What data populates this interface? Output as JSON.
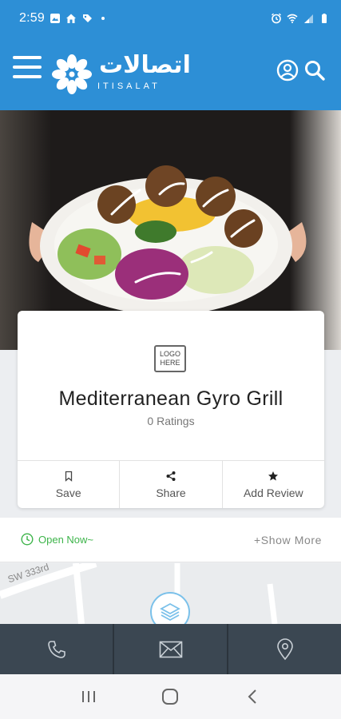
{
  "status_bar": {
    "time": "2:59"
  },
  "header": {
    "brand_arabic": "اتصالات",
    "brand_latin": "ITISALAT",
    "colors": {
      "primary": "#2d8fd6"
    }
  },
  "listing": {
    "logo_placeholder": [
      "LOGO",
      "HERE"
    ],
    "name": "Mediterranean Gyro Grill",
    "ratings": "0 Ratings",
    "actions": [
      {
        "label": "Save",
        "icon": "bookmark-icon"
      },
      {
        "label": "Share",
        "icon": "share-icon"
      },
      {
        "label": "Add Review",
        "icon": "star-icon"
      }
    ]
  },
  "hours": {
    "status": "Open Now~",
    "show_more": "+Show More",
    "status_color": "#3db44a"
  },
  "map": {
    "street_label": "SW 333rd"
  },
  "bottom_bar": {
    "items": [
      "phone-icon",
      "mail-icon",
      "location-pin-icon"
    ],
    "color": "#3b4752"
  },
  "system_nav": [
    "recent-apps-icon",
    "home-icon",
    "back-icon"
  ]
}
